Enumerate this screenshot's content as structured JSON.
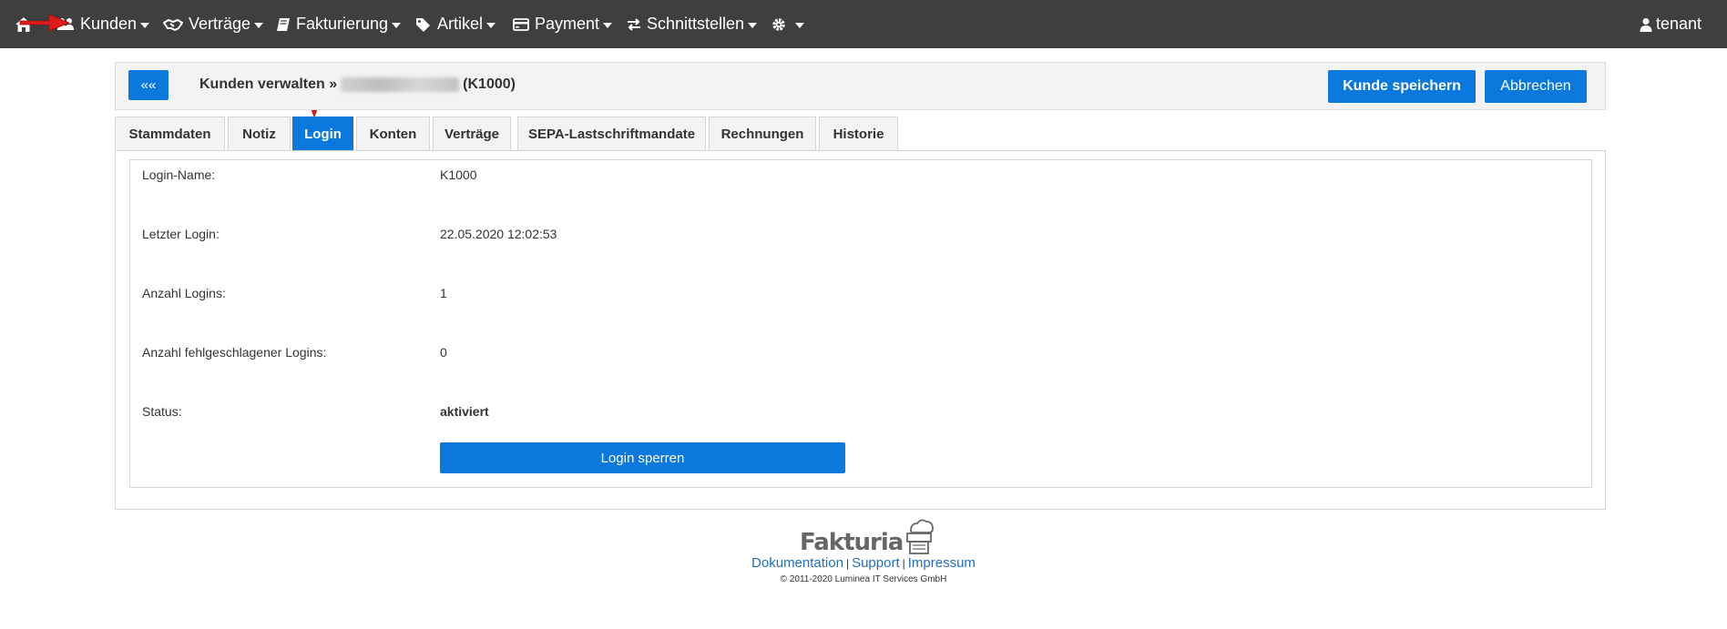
{
  "navbar": {
    "items": [
      {
        "label": "Kunden",
        "icon": "users-icon"
      },
      {
        "label": "Verträge",
        "icon": "handshake-icon"
      },
      {
        "label": "Fakturierung",
        "icon": "book-icon"
      },
      {
        "label": "Artikel",
        "icon": "tags-icon"
      },
      {
        "label": "Payment",
        "icon": "credit-card-icon"
      },
      {
        "label": "Schnittstellen",
        "icon": "exchange-icon"
      }
    ],
    "home_icon": "home-icon",
    "settings_icon": "gear-icon",
    "user": {
      "label": "tenant",
      "icon": "user-icon"
    }
  },
  "header": {
    "back_label": "««",
    "breadcrumb_prefix": "Kunden verwalten »",
    "customer_id": "(K1000)",
    "save_label": "Kunde speichern",
    "cancel_label": "Abbrechen"
  },
  "tabs": [
    {
      "label": "Stammdaten",
      "active": false
    },
    {
      "label": "Notiz",
      "active": false
    },
    {
      "label": "Login",
      "active": true
    },
    {
      "label": "Konten",
      "active": false
    },
    {
      "label": "Verträge",
      "active": false
    },
    {
      "label": "SEPA-Lastschriftmandate",
      "active": false
    },
    {
      "label": "Rechnungen",
      "active": false
    },
    {
      "label": "Historie",
      "active": false
    }
  ],
  "login": {
    "rows": [
      {
        "label": "Login-Name:",
        "value": "K1000"
      },
      {
        "label": "Letzter Login:",
        "value": "22.05.2020 12:02:53"
      },
      {
        "label": "Anzahl Logins:",
        "value": "1"
      },
      {
        "label": "Anzahl fehlgeschlagener Logins:",
        "value": "0"
      },
      {
        "label": "Status:",
        "value": "aktiviert"
      }
    ],
    "lock_button_label": "Login sperren"
  },
  "footer": {
    "logo_text": "Fakturia",
    "links": [
      "Dokumentation",
      "Support",
      "Impressum"
    ],
    "separator": "|",
    "copyright": "© 2011-2020 Luminea IT Services GmbH"
  },
  "colors": {
    "navbar_bg": "#3f3f3f",
    "primary": "#0a78dc",
    "annotation_red": "#e01b1b",
    "link": "#1f6fbf"
  }
}
